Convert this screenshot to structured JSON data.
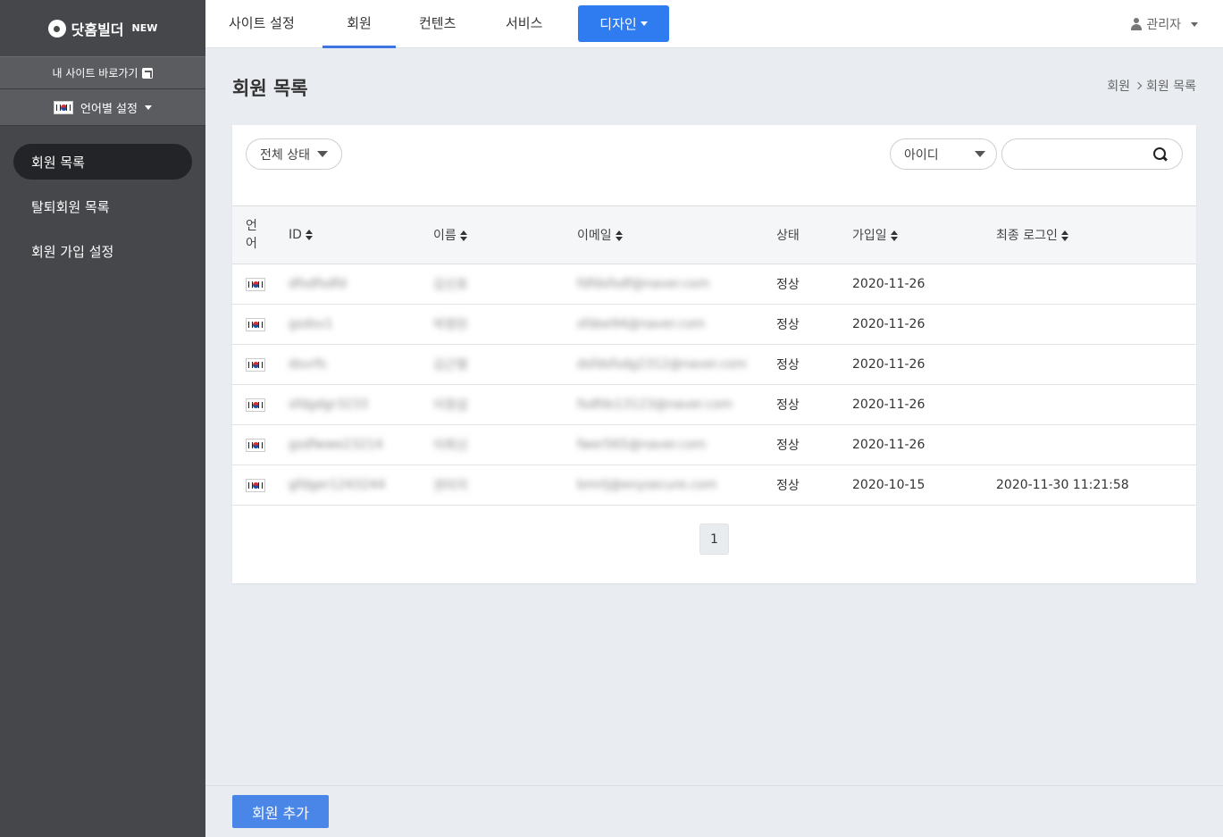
{
  "sidebar": {
    "logo": {
      "text": "닷홈빌더",
      "badge": "NEW"
    },
    "site_link": "내 사이트 바로가기",
    "language_label": "언어별 설정",
    "nav": [
      {
        "label": "회원 목록",
        "active": true
      },
      {
        "label": "탈퇴회원 목록",
        "active": false
      },
      {
        "label": "회원 가입 설정",
        "active": false
      }
    ]
  },
  "topbar": {
    "tabs": [
      {
        "label": "사이트 설정"
      },
      {
        "label": "회원"
      },
      {
        "label": "컨텐츠"
      },
      {
        "label": "서비스"
      }
    ],
    "design_button": "디자인",
    "admin_label": "관리자"
  },
  "page": {
    "title": "회원 목록",
    "breadcrumb": [
      "회원",
      "회원 목록"
    ]
  },
  "filters": {
    "status_select": "전체 상태",
    "search_field_select": "아이디",
    "search_value": ""
  },
  "table": {
    "headers": {
      "lang": "언어",
      "id": "ID",
      "name": "이름",
      "email": "이메일",
      "status": "상태",
      "joined": "가입일",
      "last_login": "최종 로그인"
    },
    "rows": [
      {
        "id": "dfsdfsdfd",
        "name": "김신호",
        "email": "fdfdsfsdf@naver.com",
        "status": "정상",
        "joined": "2020-11-26",
        "last_login": ""
      },
      {
        "id": "gsdsv1",
        "name": "박정민",
        "email": "sfdee94@naver.com",
        "status": "정상",
        "joined": "2020-11-26",
        "last_login": ""
      },
      {
        "id": "dsvrfs",
        "name": "김근형",
        "email": "dsfdsfsdg2312@naver.com",
        "status": "정상",
        "joined": "2020-11-26",
        "last_login": ""
      },
      {
        "id": "sfdgdgr3233",
        "name": "이정섭",
        "email": "fsdfds13123@naver.com",
        "status": "정상",
        "joined": "2020-11-26",
        "last_login": ""
      },
      {
        "id": "gsdfwwe23214",
        "name": "이희신",
        "email": "fwer565@naver.com",
        "status": "정상",
        "joined": "2020-11-26",
        "last_login": ""
      },
      {
        "id": "gfdger1243244",
        "name": "권미지",
        "email": "bmrlj@enysecure.com",
        "status": "정상",
        "joined": "2020-10-15",
        "last_login": "2020-11-30 11:21:58"
      }
    ]
  },
  "pagination": {
    "current": "1"
  },
  "footer": {
    "add_button": "회원 추가"
  },
  "colors": {
    "accent": "#2f7cf0",
    "sidebar": "#45474b",
    "active_nav": "#232427"
  }
}
